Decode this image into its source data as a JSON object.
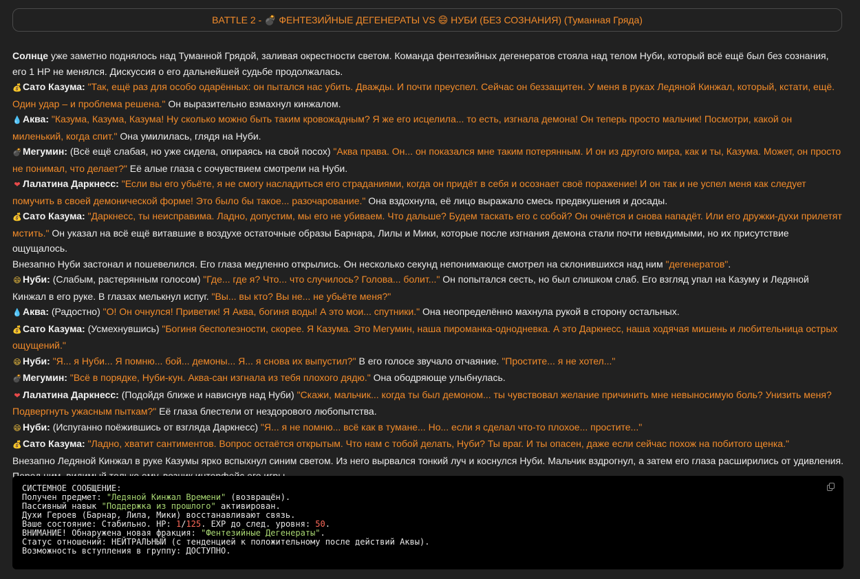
{
  "header": {
    "title": "BATTLE 2 - 💣 ФЕНТЕЗИЙНЫЕ ДЕГЕНЕРАТЫ VS 😄 НУБИ (БЕЗ СОЗНАНИЯ) (Туманная Гряда)"
  },
  "story": {
    "p1": {
      "bold": "Солнце",
      "text": " уже заметно поднялось над Туманной Грядой, заливая окрестности светом. Команда фентезийных дегенератов стояла над телом Нуби, который всё ещё был без сознания, его 1 HP не менялся. Дискуссия о его дальнейшей судьбе продолжалась."
    },
    "p2": {
      "speaker": "Сато Казума:",
      "q1": "\"Так, ещё раз для особо одарённых: он пытался нас убить. Дважды. И почти преуспел. Сейчас он беззащитен. У меня в руках Ледяной Кинжал, который, кстати, ещё. Один удар – и проблема решена.\"",
      "after": " Он выразительно взмахнул кинжалом."
    },
    "p3": {
      "speaker": "Аква:",
      "q1": "\"Казума, Казума, Казума! Ну сколько можно быть таким кровожадным? Я же его исцелила... то есть, изгнала демона! Он теперь просто мальчик! Посмотри, какой он миленький, когда спит.\"",
      "after": " Она умилилась, глядя на Нуби."
    },
    "p4": {
      "speaker": "Мегумин:",
      "pre": " (Всё ещё слабая, но уже сидела, опираясь на свой посох) ",
      "q1": "\"Аква права. Он... он показался мне таким потерянным. И он из другого мира, как и ты, Казума. Может, он просто не понимал, что делает?\"",
      "after": " Её алые глаза с сочувствием смотрели на Нуби."
    },
    "p5": {
      "speaker": "Лалатина Даркнесс:",
      "q1": "\"Если вы его убьёте, я не смогу насладиться его страданиями, когда он придёт в себя и осознает своё поражение! И он так и не успел меня как следует помучить в своей демонической форме! Это было бы такое... разочарование.\"",
      "after": " Она вздохнула, её лицо выражало смесь предвкушения и досады."
    },
    "p6": {
      "speaker": "Сато Казума:",
      "q1": "\"Даркнесс, ты неисправима. Ладно, допустим, мы его не убиваем. Что дальше? Будем таскать его с собой? Он очнётся и снова нападёт. Или его дружки-духи прилетят мстить.\"",
      "after": " Он указал на всё ещё витавшие в воздухе остаточные образы Барнара, Лилы и Мики, которые после изгнания демона стали почти невидимыми, но их присутствие ощущалось."
    },
    "p7": {
      "text": "Внезапно Нуби застонал и пошевелился. Его глаза медленно открылись. Он несколько секунд непонимающе смотрел на склонившихся над ним ",
      "q1": "\"дегенератов\"",
      "after": "."
    },
    "p8": {
      "speaker": "Нуби:",
      "pre": " (Слабым, растерянным голосом) ",
      "q1": "\"Где... где я? Что... что случилось? Голова... болит...\"",
      "mid": " Он попытался сесть, но был слишком слаб. Его взгляд упал на Казуму и Ледяной Кинжал в его руке. В глазах мелькнул испуг. ",
      "q2": "\"Вы... вы кто? Вы не... не убьёте меня?\""
    },
    "p9": {
      "speaker": "Аква:",
      "pre": " (Радостно) ",
      "q1": "\"О! Он очнулся! Приветик! Я Аква, богиня воды! А это мои... спутники.\"",
      "after": " Она неопределённо махнула рукой в сторону остальных."
    },
    "p10": {
      "speaker": "Сато Казума:",
      "pre": " (Усмехнувшись) ",
      "q1": "\"Богиня бесполезности, скорее. Я Казума. Это Мегумин, наша пироманка-однодневка. А это Даркнесс, наша ходячая мишень и любительница острых ощущений.\""
    },
    "p11": {
      "speaker": "Нуби:",
      "q1": "\"Я... я Нуби... Я помню... бой... демоны... Я... я снова их выпустил?\"",
      "mid": " В его голосе звучало отчаяние. ",
      "q2": "\"Простите... я не хотел...\""
    },
    "p12": {
      "speaker": "Мегумин:",
      "q1": "\"Всё в порядке, Нуби-кун. Аква-сан изгнала из тебя плохого дядю.\"",
      "after": " Она ободряюще улыбнулась."
    },
    "p13": {
      "speaker": "Лалатина Даркнесс:",
      "pre": " (Подойдя ближе и нависнув над Нуби) ",
      "q1": "\"Скажи, мальчик... когда ты был демоном... ты чувствовал желание причинить мне невыносимую боль? Унизить меня? Подвергнуть ужасным пыткам?\"",
      "after": " Её глаза блестели от нездорового любопытства."
    },
    "p14": {
      "speaker": "Нуби:",
      "pre": " (Испуганно поёжившись от взгляда Даркнесс) ",
      "q1": "\"Я... я не помню... всё как в тумане... Но... если я сделал что-то плохое... простите...\""
    },
    "p15": {
      "speaker": "Сато Казума:",
      "q1": "\"Ладно, хватит сантиментов. Вопрос остаётся открытым. Что нам с тобой делать, Нуби? Ты враг. И ты опасен, даже если сейчас похож на побитого щенка.\""
    },
    "p16": {
      "text": "Внезапно Ледяной Кинжал в руке Казумы ярко вспыхнул синим светом. Из него вырвался тонкий луч и коснулся Нуби. Мальчик вздрогнул, а затем его глаза расширились от удивления. Перед ним, видимый только ему, возник интерфейс его игры."
    }
  },
  "icons": {
    "bomb": "💣",
    "money": "💰",
    "drop": "💧",
    "heart": "❤",
    "smile": "😄"
  },
  "system": {
    "l1": "СИСТЕМНОЕ СООБЩЕНИЕ:",
    "l2a": "Получен предмет: ",
    "l2b": "\"Ледяной Кинжал Времени\"",
    "l2c": " (возвращён).",
    "l3a": "Пассивный навык ",
    "l3b": "\"Поддержка из прошлого\"",
    "l3c": " активирован.",
    "l4": "Духи Героев (Барнар, Лила, Мики) восстанавливают связь.",
    "l5a": "Ваше состояние: Стабильно. HP: ",
    "l5b": "1",
    "l5c": "/",
    "l5d": "125",
    "l5e": ". EXP до след. уровня: ",
    "l5f": "50",
    "l5g": ".",
    "l6a": "ВНИМАНИЕ! Обнаружена новая фракция: ",
    "l6b": "\"Фентезийные Дегенераты\"",
    "l6c": ".",
    "l7": "Статус отношений: НЕЙТРАЛЬНЫЙ (с тенденцией к положительному после действий Аквы).",
    "l8": "Возможность вступления в группу: ДОСТУПНО."
  }
}
